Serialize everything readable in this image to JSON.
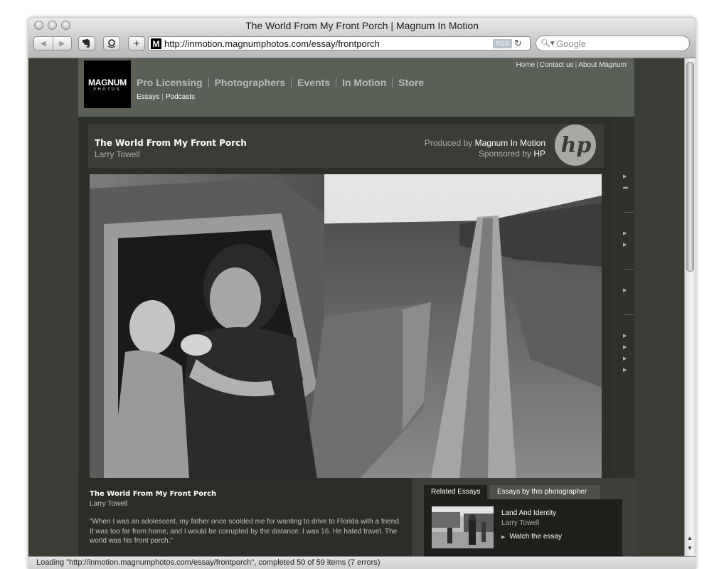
{
  "browser": {
    "window_title": "The World From My Front Porch | Magnum In Motion",
    "url": "http://inmotion.magnumphotos.com/essay/frontporch",
    "rss_label": "RSS",
    "search_placeholder": "Google",
    "favicon_letter": "M",
    "status_text": "Loading \"http://inmotion.magnumphotos.com/essay/frontporch\", completed 50 of 59 items (7 errors)"
  },
  "site": {
    "logo": {
      "main": "MAGNUM",
      "sub": "PHOTOS"
    },
    "top_links": [
      "Home",
      "Contact us",
      "About Magnum"
    ],
    "main_nav": [
      "Pro Licensing",
      "Photographers",
      "Events",
      "In Motion",
      "Store"
    ],
    "sub_nav": [
      "Essays",
      "Podcasts"
    ]
  },
  "essay": {
    "title": "The World From My Front Porch",
    "author": "Larry Towell",
    "produced_by_label": "Produced by",
    "produced_by": "Magnum In Motion",
    "sponsored_by_label": "Sponsored by",
    "sponsored_by": "HP",
    "quote": "\"When I was an adolescent, my father once scolded me for wanting to drive to Florida with a friend. It was too far from home, and I would be corrupted by the distance. I was 16. He hated travel. The world was his front porch.\""
  },
  "related": {
    "tabs": [
      "Related Essays",
      "Essays by this photographer"
    ],
    "item": {
      "title": "Land And Identity",
      "author": "Larry Towell",
      "action": "Watch the essay"
    }
  },
  "colors": {
    "page_bg": "#3a3e37",
    "header_bg": "#5b6057",
    "nav_text": "#b7bbb4",
    "panel_dark": "#1e201c"
  }
}
